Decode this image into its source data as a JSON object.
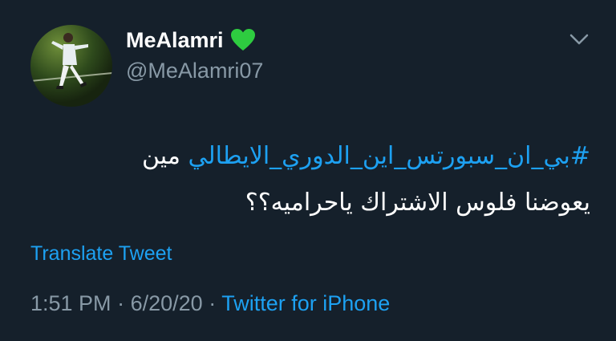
{
  "author": {
    "display_name": "MeAlamri",
    "handle": "@MeAlamri07",
    "badge_icon": "green-heart-icon",
    "badge_color": "#2ecc40"
  },
  "menu": {
    "icon": "chevron-down-icon"
  },
  "tweet": {
    "text_prefix": "مين",
    "hashtag": "#بي_ان_سبورتس_اين_الدوري_الايطالي",
    "text_line2": "يعوضنا فلوس الاشتراك ياحراميه؟؟"
  },
  "translate_label": "Translate Tweet",
  "meta": {
    "time": "1:51 PM",
    "separator": "·",
    "date": "6/20/20",
    "source": "Twitter for iPhone"
  },
  "colors": {
    "background": "#15202b",
    "accent": "#1da1f2",
    "secondary_text": "#8899a6"
  }
}
